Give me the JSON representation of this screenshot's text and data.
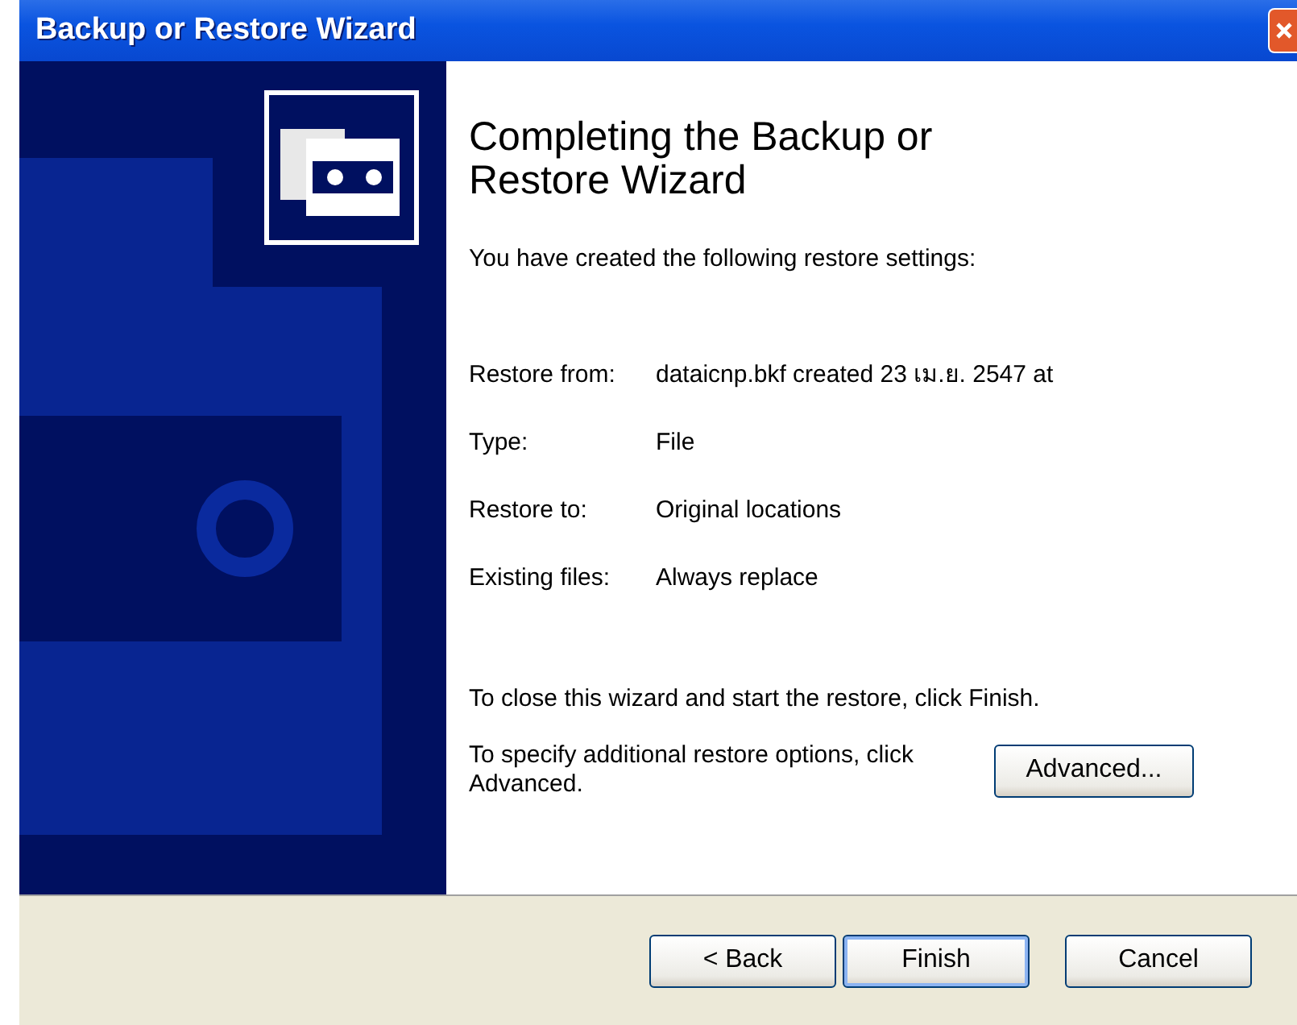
{
  "window": {
    "title": "Backup or Restore Wizard"
  },
  "heading": "Completing the Backup or Restore Wizard",
  "intro": "You have created the following restore settings:",
  "settings": [
    {
      "label": "Restore from:",
      "value": "dataicnp.bkf created 23 เม.ย. 2547 at"
    },
    {
      "label": "Type:",
      "value": "File"
    },
    {
      "label": "Restore to:",
      "value": "Original locations"
    },
    {
      "label": "Existing files:",
      "value": "Always replace"
    }
  ],
  "close_note": "To close this wizard and start the restore, click Finish.",
  "advanced_note": "To specify additional restore options, click Advanced.",
  "advanced_button": "Advanced...",
  "buttons": [
    {
      "label": "< Back",
      "default": false
    },
    {
      "label": "Finish",
      "default": true
    },
    {
      "label": "Cancel",
      "default": false
    }
  ]
}
